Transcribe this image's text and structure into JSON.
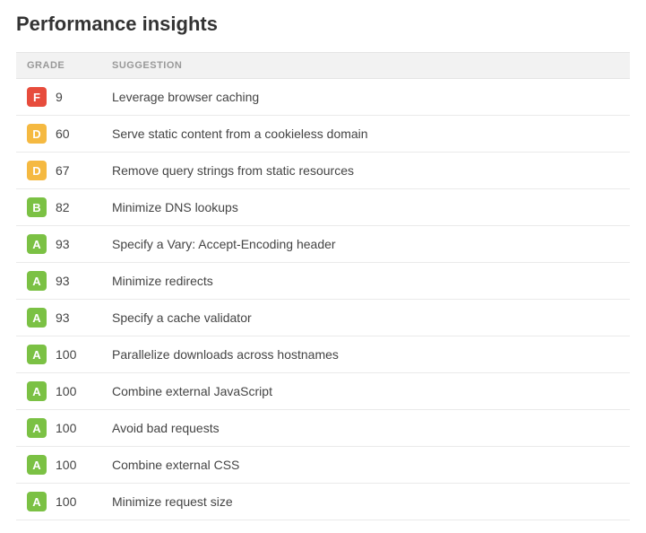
{
  "title": "Performance insights",
  "headers": {
    "grade": "GRADE",
    "suggestion": "SUGGESTION"
  },
  "grade_colors": {
    "A": "#7bc144",
    "B": "#7bc144",
    "C": "#f5b941",
    "D": "#f5b941",
    "F": "#e74c3c"
  },
  "rows": [
    {
      "grade": "F",
      "score": 9,
      "suggestion": "Leverage browser caching"
    },
    {
      "grade": "D",
      "score": 60,
      "suggestion": "Serve static content from a cookieless domain"
    },
    {
      "grade": "D",
      "score": 67,
      "suggestion": "Remove query strings from static resources"
    },
    {
      "grade": "B",
      "score": 82,
      "suggestion": "Minimize DNS lookups"
    },
    {
      "grade": "A",
      "score": 93,
      "suggestion": "Specify a Vary: Accept-Encoding header"
    },
    {
      "grade": "A",
      "score": 93,
      "suggestion": "Minimize redirects"
    },
    {
      "grade": "A",
      "score": 93,
      "suggestion": "Specify a cache validator"
    },
    {
      "grade": "A",
      "score": 100,
      "suggestion": "Parallelize downloads across hostnames"
    },
    {
      "grade": "A",
      "score": 100,
      "suggestion": "Combine external JavaScript"
    },
    {
      "grade": "A",
      "score": 100,
      "suggestion": "Avoid bad requests"
    },
    {
      "grade": "A",
      "score": 100,
      "suggestion": "Combine external CSS"
    },
    {
      "grade": "A",
      "score": 100,
      "suggestion": "Minimize request size"
    }
  ]
}
